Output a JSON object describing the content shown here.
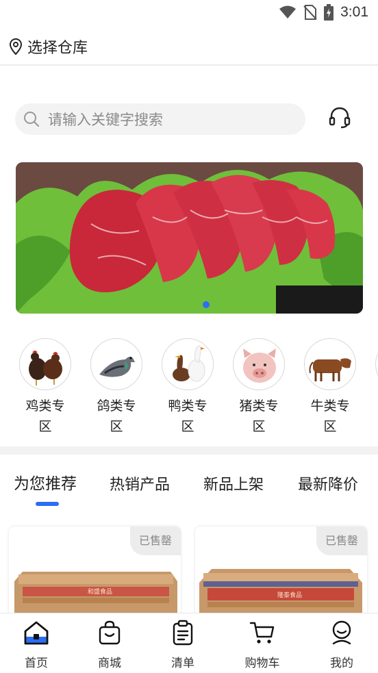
{
  "status_bar": {
    "time": "3:01",
    "icons": [
      "wifi-icon",
      "no-sim-icon",
      "battery-charging-icon"
    ]
  },
  "header": {
    "location_icon": "location-pin-icon",
    "warehouse_label": "选择仓库"
  },
  "search": {
    "placeholder": "请输入关键字搜索",
    "icon": "search-icon",
    "service_icon": "headset-icon"
  },
  "banner": {
    "image": "raw-beef-steak-slices-on-lettuce",
    "active_dot_color": "#2b6df5"
  },
  "categories": [
    {
      "label": "鸡类专区",
      "image": "chickens"
    },
    {
      "label": "鸽类专区",
      "image": "pigeon"
    },
    {
      "label": "鸭类专区",
      "image": "ducks-goose"
    },
    {
      "label": "猪类专区",
      "image": "pig"
    },
    {
      "label": "牛类专区",
      "image": "cow"
    }
  ],
  "tabs": [
    {
      "label": "为您推荐",
      "active": true
    },
    {
      "label": "热销产品",
      "active": false
    },
    {
      "label": "新品上架",
      "active": false
    },
    {
      "label": "最新降价",
      "active": false
    }
  ],
  "products": [
    {
      "badge": "已售罄",
      "image": "cardboard-box"
    },
    {
      "badge": "已售罄",
      "image": "cardboard-box"
    }
  ],
  "bottom_nav": [
    {
      "label": "首页",
      "icon": "home-icon",
      "active": true
    },
    {
      "label": "商城",
      "icon": "shopping-bag-icon",
      "active": false
    },
    {
      "label": "清单",
      "icon": "clipboard-list-icon",
      "active": false
    },
    {
      "label": "购物车",
      "icon": "cart-icon",
      "active": false
    },
    {
      "label": "我的",
      "icon": "user-icon",
      "active": false
    }
  ],
  "colors": {
    "accent": "#2b6df5",
    "text": "#222222",
    "muted": "#8a8a8a"
  }
}
